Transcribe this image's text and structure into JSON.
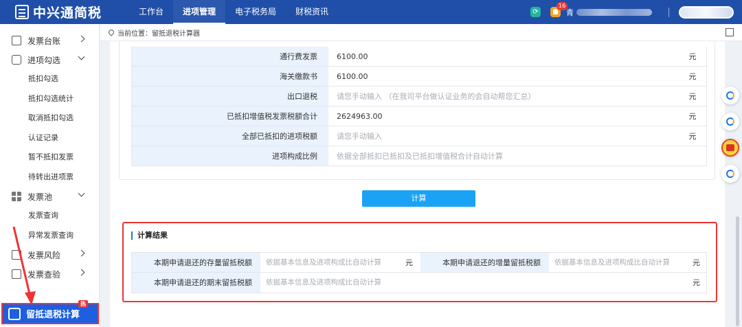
{
  "app": {
    "title": "中兴通简税"
  },
  "topnav": {
    "items": [
      {
        "label": "工作台"
      },
      {
        "label": "进项管理"
      },
      {
        "label": "电子税务局"
      },
      {
        "label": "财税资讯"
      }
    ],
    "active_index": 1,
    "notification_count": "16",
    "user_prefix": "青"
  },
  "sidebar": {
    "groups": [
      {
        "label": "发票台账",
        "icon": "edit-icon",
        "state": "collapsed"
      },
      {
        "label": "进项勾选",
        "icon": "checklist-icon",
        "state": "expanded",
        "items": [
          "抵扣勾选",
          "抵扣勾选统计",
          "取消抵扣勾选",
          "认证记录",
          "暂不抵扣发票",
          "待转出进项票"
        ]
      },
      {
        "label": "发票池",
        "icon": "grid-icon",
        "state": "expanded",
        "items": [
          "发票查询",
          "异常发票查询"
        ]
      },
      {
        "label": "发票风险",
        "icon": "chart-icon",
        "state": "collapsed"
      },
      {
        "label": "发票查验",
        "icon": "search-doc-icon",
        "state": "collapsed"
      }
    ],
    "floating_tab": {
      "label": "留抵退税计算",
      "badge": "热"
    }
  },
  "breadcrumb": {
    "prefix": "当前位置：",
    "current": "留抵退税计算器"
  },
  "form": {
    "rows": [
      {
        "label": "通行费发票",
        "value": "6100.00",
        "placeholder": false,
        "unit": "元"
      },
      {
        "label": "海关缴款书",
        "value": "6100.00",
        "placeholder": false,
        "unit": "元"
      },
      {
        "label": "出口退税",
        "value": "请您手动输入 （在我司平台做认证业务的会自动帮您汇总）",
        "placeholder": true,
        "unit": "元"
      },
      {
        "label": "已抵扣增值税发票税额合计",
        "value": "2624963.00",
        "placeholder": false,
        "unit": "元"
      },
      {
        "label": "全部已抵扣的进项税额",
        "value": "请您手动输入",
        "placeholder": true,
        "unit": "元"
      },
      {
        "label": "进项构成比例",
        "value": "依据全部抵扣已抵扣及已抵扣增值税合计自动计算",
        "placeholder": true,
        "unit": ""
      }
    ]
  },
  "calculate_button": {
    "label": "计算"
  },
  "result": {
    "title": "计算结果",
    "row1": {
      "left_label": "本期申请退还的存量留抵税额",
      "left_value": "依据基本信息及进项构成比自动计算",
      "left_unit": "元",
      "right_label": "本期申请退还的增量留抵税额",
      "right_value": "依据基本信息及进项构成比自动计算",
      "right_unit": "元"
    },
    "row2": {
      "label": "本期申请退还的期末留抵税额",
      "value": "依据基本信息及进项构成比自动计算",
      "unit": "元"
    }
  },
  "colors": {
    "header": "#1f4fa8",
    "accent": "#1aa3f5",
    "label_bg": "#e9f2fd",
    "highlight": "#ee3333"
  }
}
